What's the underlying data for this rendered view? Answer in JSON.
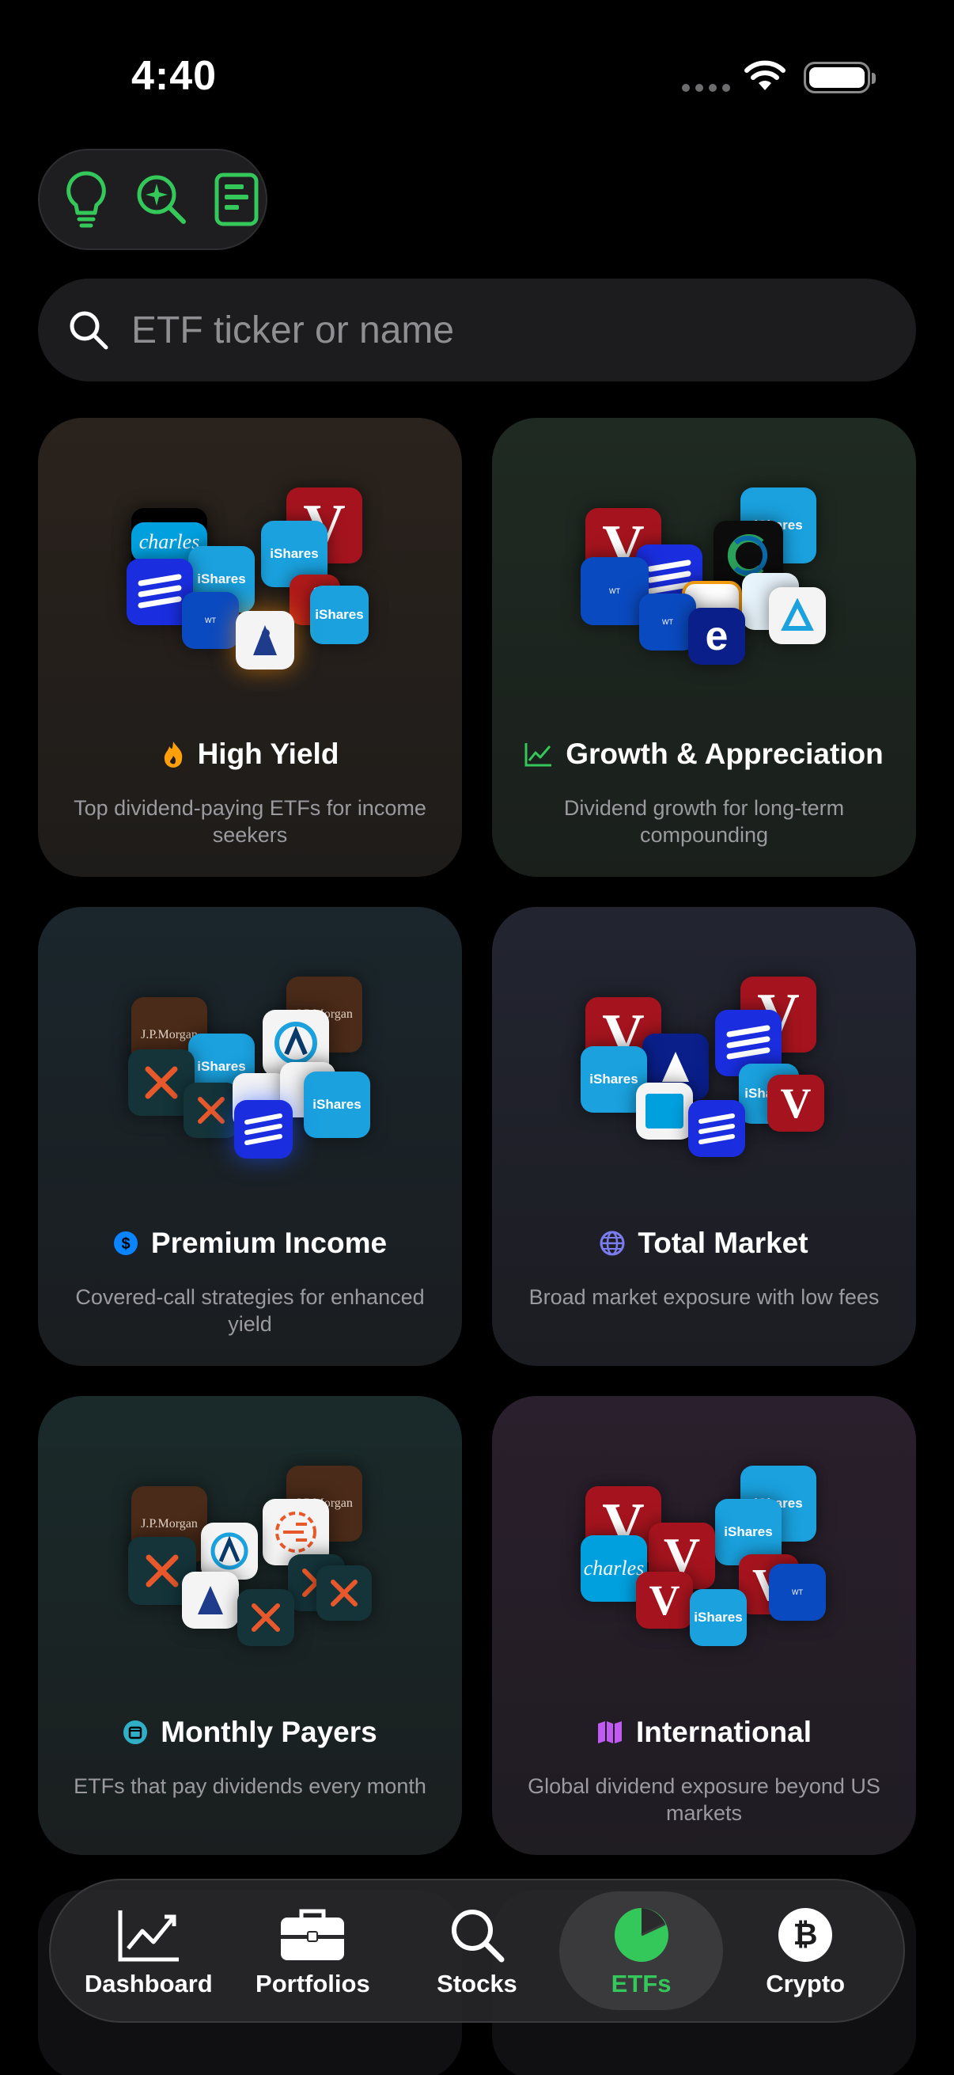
{
  "status_bar": {
    "time": "4:40"
  },
  "search": {
    "placeholder": "ETF ticker or name"
  },
  "cards": [
    {
      "title": "High Yield",
      "description": "Top dividend-paying ETFs for income seekers",
      "icon": "flame-icon",
      "accent": "#ff9f0a"
    },
    {
      "title": "Growth & Appreciation",
      "description": "Dividend growth for long-term compounding",
      "icon": "chart-line-icon",
      "accent": "#34c759"
    },
    {
      "title": "Premium Income",
      "description": "Covered-call strategies for enhanced yield",
      "icon": "dollar-circle-icon",
      "accent": "#0a84ff"
    },
    {
      "title": "Total Market",
      "description": "Broad market exposure with low fees",
      "icon": "globe-icon",
      "accent": "#5e5ce6"
    },
    {
      "title": "Monthly Payers",
      "description": "ETFs that pay dividends every month",
      "icon": "calendar-icon",
      "accent": "#30b0c7"
    },
    {
      "title": "International",
      "description": "Global dividend exposure beyond US markets",
      "icon": "map-icon",
      "accent": "#bf5af2"
    }
  ],
  "logos": {
    "vanguard": "V",
    "ishares": "iShares",
    "schwab": "charles",
    "jpmorgan": "J.P.Morgan"
  },
  "tabs": [
    {
      "label": "Dashboard",
      "icon": "chart-line-icon",
      "active": false
    },
    {
      "label": "Portfolios",
      "icon": "briefcase-icon",
      "active": false
    },
    {
      "label": "Stocks",
      "icon": "search-icon",
      "active": false
    },
    {
      "label": "ETFs",
      "icon": "pie-chart-icon",
      "active": true
    },
    {
      "label": "Crypto",
      "icon": "bitcoin-icon",
      "active": false
    }
  ],
  "colors": {
    "active_tab": "#34c759",
    "background": "#000000"
  }
}
